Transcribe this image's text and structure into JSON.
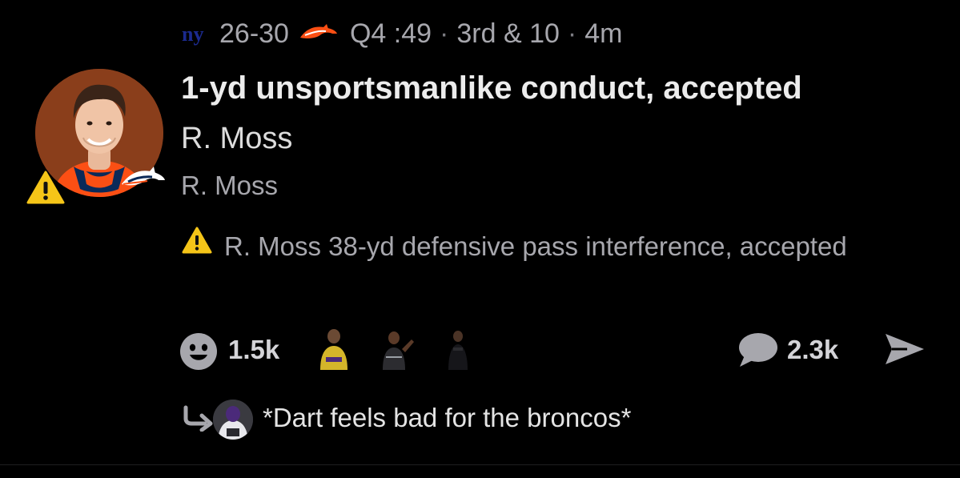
{
  "header": {
    "home_team_logo_text": "ny",
    "score": "26-30",
    "away_team_logo": "broncos-horse-icon",
    "quarter_clock": "Q4 :49",
    "down_distance": "3rd & 10",
    "time_ago": "4m",
    "separator": "·"
  },
  "play": {
    "title": "1-yd unsportsmanlike conduct, accepted",
    "player_name_primary": "R. Moss",
    "player_name_secondary": "R. Moss",
    "penalty_text": "R. Moss 38-yd defensive pass interference, accepted",
    "warning_icon": "warning-icon"
  },
  "reactions": {
    "smiley_icon": "smiley-icon",
    "count": "1.5k",
    "reactor_icons": [
      "reactor-avatar",
      "reactor-avatar",
      "reactor-avatar"
    ]
  },
  "comments": {
    "icon": "speech-bubble-icon",
    "count": "2.3k"
  },
  "share": {
    "icon": "share-arrow-icon"
  },
  "reply": {
    "icon": "reply-arrow-icon",
    "text": "*Dart feels bad for the broncos*"
  },
  "colors": {
    "background": "#000000",
    "primary_text": "#ececec",
    "secondary_text": "#a7a7ad",
    "warning_yellow": "#f5c518",
    "avatar_background": "#8a3e1b",
    "giants_blue": "#1b2a8e",
    "broncos_orange": "#fb4f14"
  }
}
